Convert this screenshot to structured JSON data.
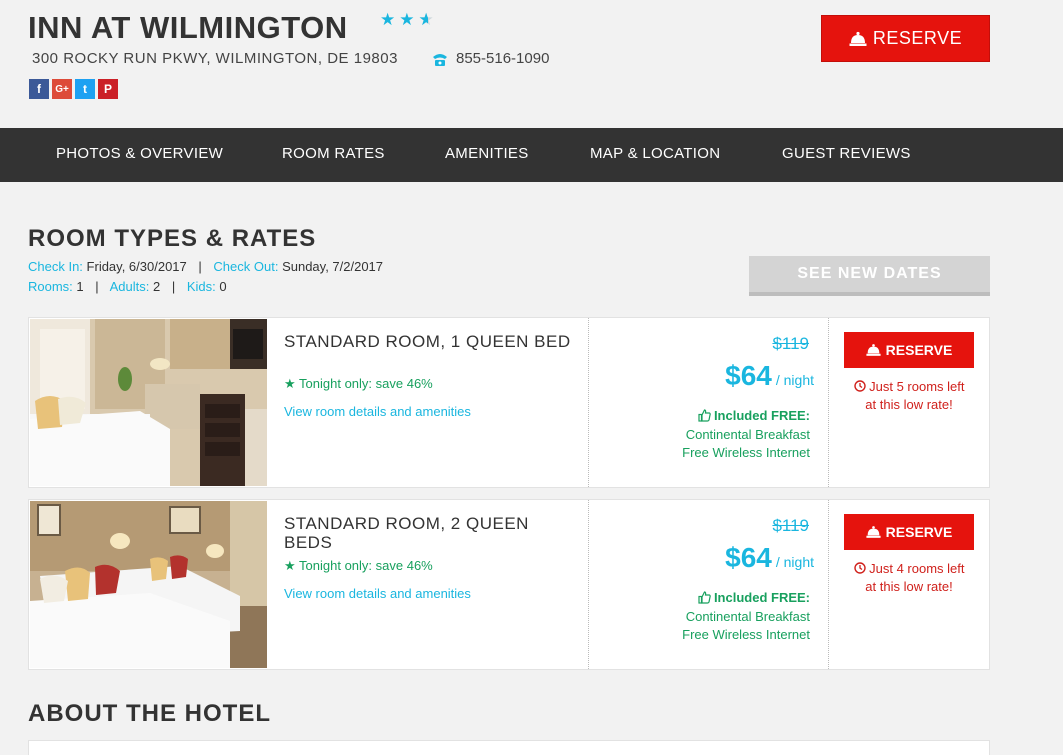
{
  "hotel": {
    "name": "INN AT WILMINGTON",
    "star_rating": 2.5,
    "address": "300 ROCKY RUN PKWY,  WILMINGTON,  DE  19803",
    "phone": "855-516-1090",
    "reserve_label": "RESERVE"
  },
  "social": {
    "facebook": "f",
    "google": "G+",
    "twitter": "t",
    "pinterest": "P"
  },
  "nav": {
    "items": [
      "PHOTOS & OVERVIEW",
      "ROOM RATES",
      "AMENITIES",
      "MAP & LOCATION",
      "GUEST REVIEWS"
    ]
  },
  "rates": {
    "title": "ROOM TYPES & RATES",
    "check_in_label": "Check In:",
    "check_in_value": "Friday, 6/30/2017",
    "check_out_label": "Check Out:",
    "check_out_value": "Sunday, 7/2/2017",
    "rooms_label": "Rooms:",
    "rooms_value": "1",
    "adults_label": "Adults:",
    "adults_value": "2",
    "kids_label": "Kids:",
    "kids_value": "0",
    "see_new_dates": "SEE NEW DATES"
  },
  "rooms": [
    {
      "name": "STANDARD ROOM, 1 QUEEN BED",
      "save": "Tonight only: save 46%",
      "details": "View room details and amenities",
      "old_price": "$119",
      "price": "$64",
      "per": "/ night",
      "included": "Included FREE:",
      "amenity1": "Continental Breakfast",
      "amenity2": "Free Wireless Internet",
      "reserve": "RESERVE",
      "note1": "Just 5 rooms left",
      "note2": "at this low rate!"
    },
    {
      "name": "STANDARD ROOM, 2 QUEEN BEDS",
      "save": "Tonight only: save 46%",
      "details": "View room details and amenities",
      "old_price": "$119",
      "price": "$64",
      "per": "/ night",
      "included": "Included FREE:",
      "amenity1": "Continental Breakfast",
      "amenity2": "Free Wireless Internet",
      "reserve": "RESERVE",
      "note1": "Just 4 rooms left",
      "note2": "at this low rate!"
    }
  ],
  "about": {
    "title": "ABOUT THE HOTEL"
  },
  "colors": {
    "accent": "#1ab6df",
    "reserve_red": "#e5130d",
    "nav_bg": "#333333",
    "green": "#18a05e"
  }
}
